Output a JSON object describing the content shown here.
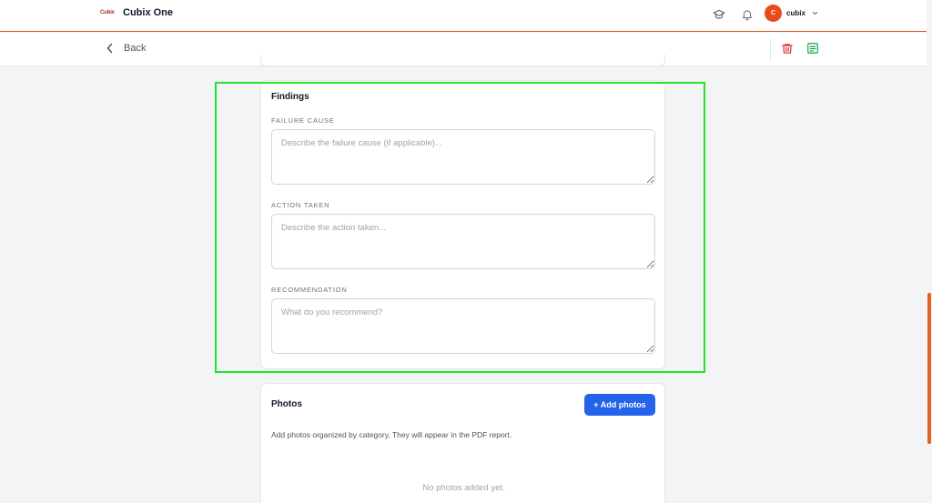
{
  "header": {
    "logo_text": "Cubix",
    "app_name": "Cubix One",
    "user": {
      "initial": "C",
      "name": "cubix"
    }
  },
  "subheader": {
    "back_label": "Back"
  },
  "findings": {
    "title": "Findings",
    "fields": [
      {
        "label": "FAILURE CAUSE",
        "placeholder": "Describe the failure cause (if applicable)...",
        "value": ""
      },
      {
        "label": "ACTION TAKEN",
        "placeholder": "Describe the action taken...",
        "value": ""
      },
      {
        "label": "RECOMMENDATION",
        "placeholder": "What do you recommend?",
        "value": ""
      }
    ]
  },
  "photos": {
    "title": "Photos",
    "add_button": "+ Add photos",
    "description": "Add photos organized by category. They will appear in the PDF report.",
    "empty_text": "No photos added yet."
  },
  "colors": {
    "brand": "#e8491d",
    "primary": "#2563eb",
    "delete": "#dc2626",
    "save": "#16a34a",
    "highlight": "#22e52b"
  }
}
